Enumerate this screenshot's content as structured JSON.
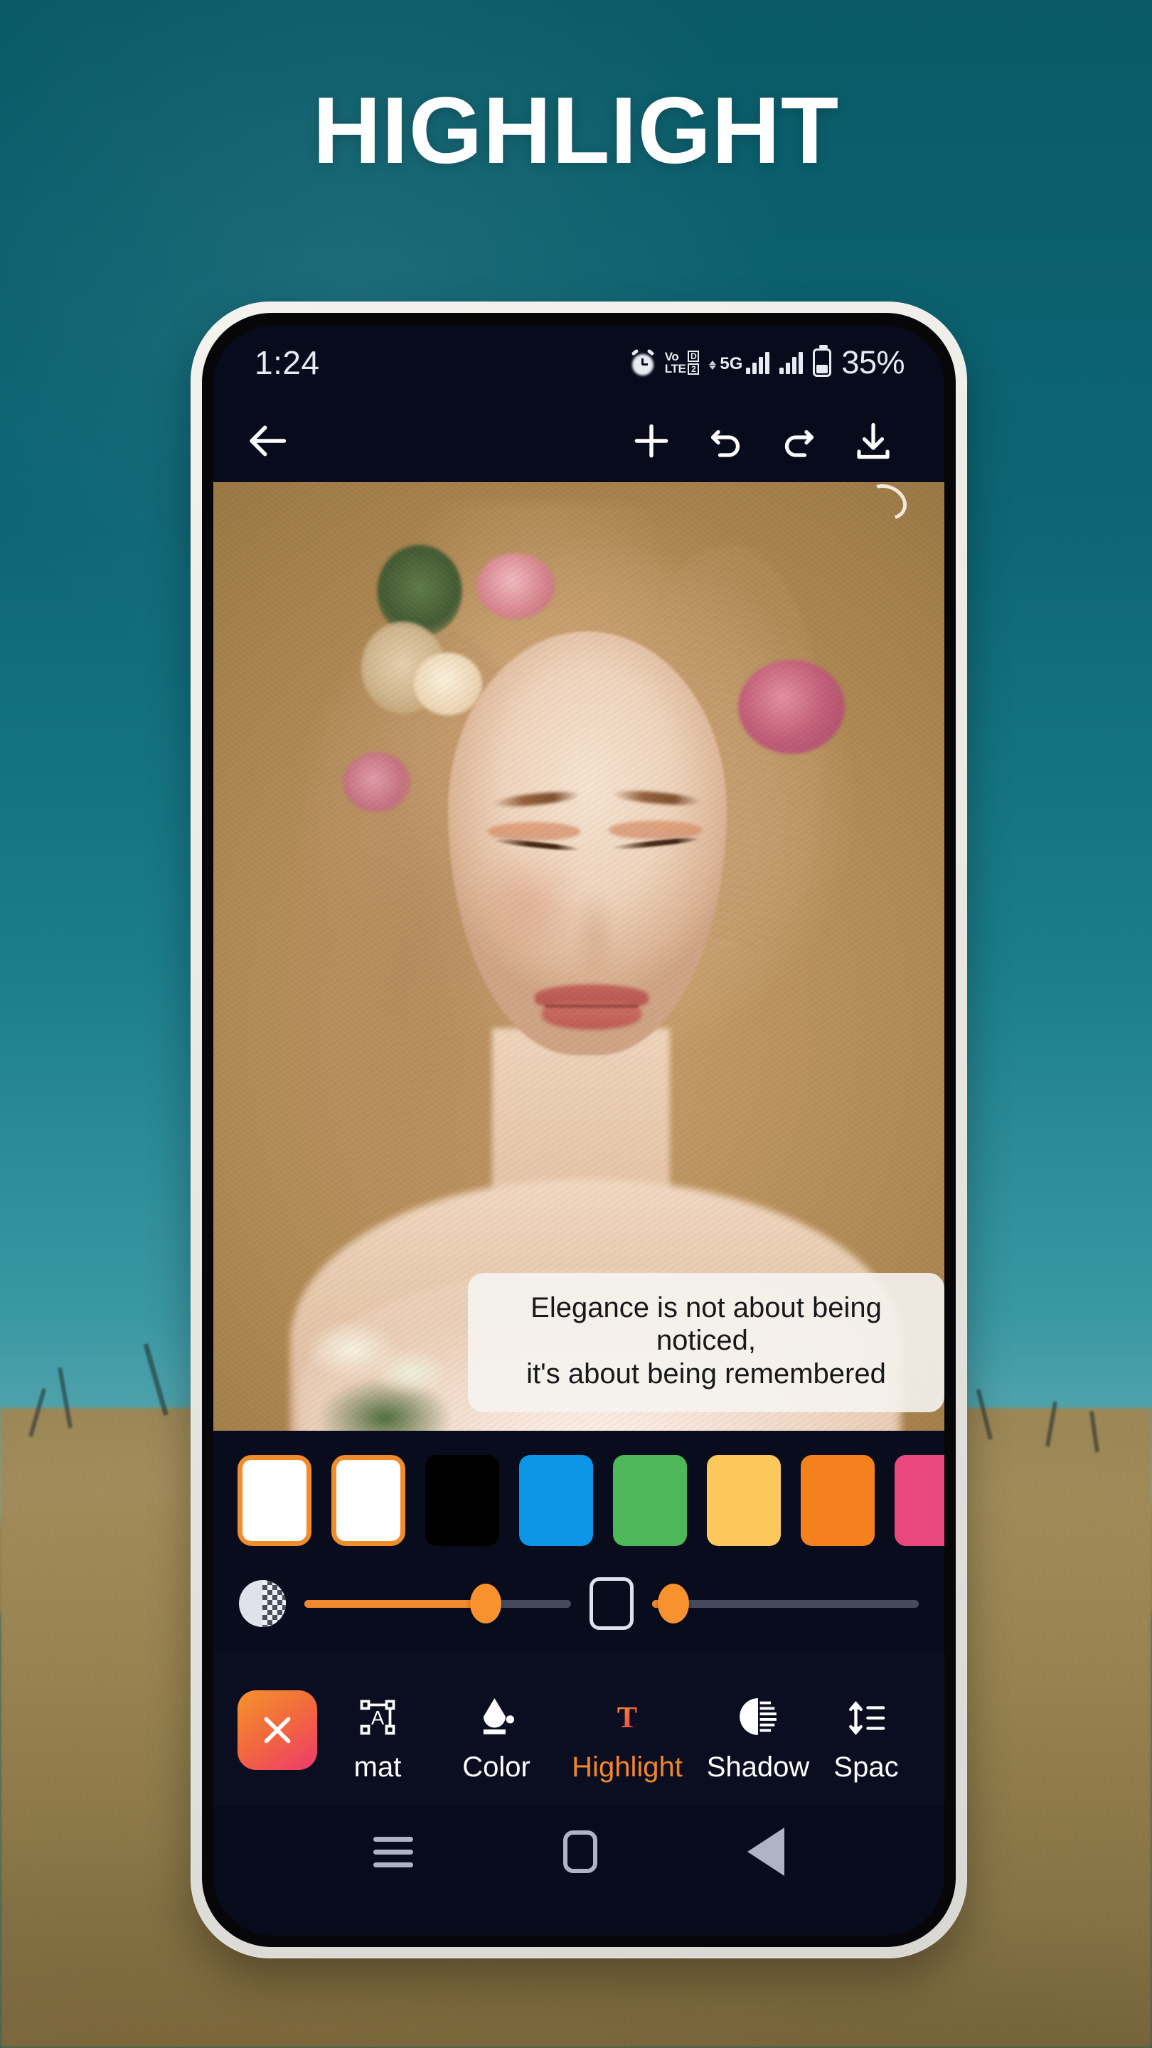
{
  "promo": {
    "title": "HIGHLIGHT",
    "bg_sky_color": "#0d6675",
    "bg_field_color": "#9b8655"
  },
  "phone": {
    "frame_color": "#efede9",
    "bezel_color": "#07070a"
  },
  "status_bar": {
    "clock": "1:24",
    "battery_percent": "35%",
    "icons": [
      "alarm-icon",
      "volte-dual-sim-icon",
      "data-arrows-icon",
      "5g-label",
      "signal-bars-sim1-icon",
      "signal-bars-sim2-icon",
      "battery-icon"
    ],
    "volte_text_line1": "Vo",
    "volte_text_line2": "LTE",
    "volte_sim_badge1": "D",
    "volte_sim_badge2": "2",
    "network_label": "5G"
  },
  "app_toolbar": {
    "back": "back-arrow-icon",
    "add": "plus-icon",
    "undo": "undo-icon",
    "redo": "redo-icon",
    "save": "download-icon"
  },
  "canvas": {
    "quote": "Elegance is not about being noticed,\nit's about being remembered",
    "quote_bg": "#f5f3f0",
    "quote_text_color": "#16181c"
  },
  "highlight_panel": {
    "accent_color": "#f0892b",
    "swatches": [
      {
        "name": "swatch-white-1",
        "color": "#ffffff",
        "selected": true
      },
      {
        "name": "swatch-white-2",
        "color": "#ffffff",
        "selected": true
      },
      {
        "name": "swatch-black",
        "color": "#000000",
        "selected": false
      },
      {
        "name": "swatch-blue",
        "color": "#0d96e8",
        "selected": false
      },
      {
        "name": "swatch-green",
        "color": "#4cb857",
        "selected": false
      },
      {
        "name": "swatch-yellow",
        "color": "#fcc85c",
        "selected": false
      },
      {
        "name": "swatch-orange",
        "color": "#f5801e",
        "selected": false
      },
      {
        "name": "swatch-pink",
        "color": "#e8487e",
        "selected": false
      }
    ],
    "sliders": [
      {
        "name": "opacity-slider",
        "icon": "opacity-checker-icon",
        "value_percent": 68
      },
      {
        "name": "corner-radius-slider",
        "icon": "rounded-rect-icon",
        "value_percent": 8
      }
    ]
  },
  "tools": {
    "close_label": "close-icon",
    "items": [
      {
        "name": "tool-format",
        "label": "mat",
        "icon": "text-format-icon",
        "active": false
      },
      {
        "name": "tool-color",
        "label": "Color",
        "icon": "paint-bucket-icon",
        "active": false
      },
      {
        "name": "tool-highlight",
        "label": "Highlight",
        "icon": "highlight-text-icon",
        "active": true
      },
      {
        "name": "tool-shadow",
        "label": "Shadow",
        "icon": "shadow-circle-icon",
        "active": false
      },
      {
        "name": "tool-spacing",
        "label": "Spac",
        "icon": "line-spacing-icon",
        "active": false
      }
    ]
  },
  "nav_bar": {
    "recents": "recents-icon",
    "home": "home-icon",
    "back": "back-triangle-icon"
  }
}
